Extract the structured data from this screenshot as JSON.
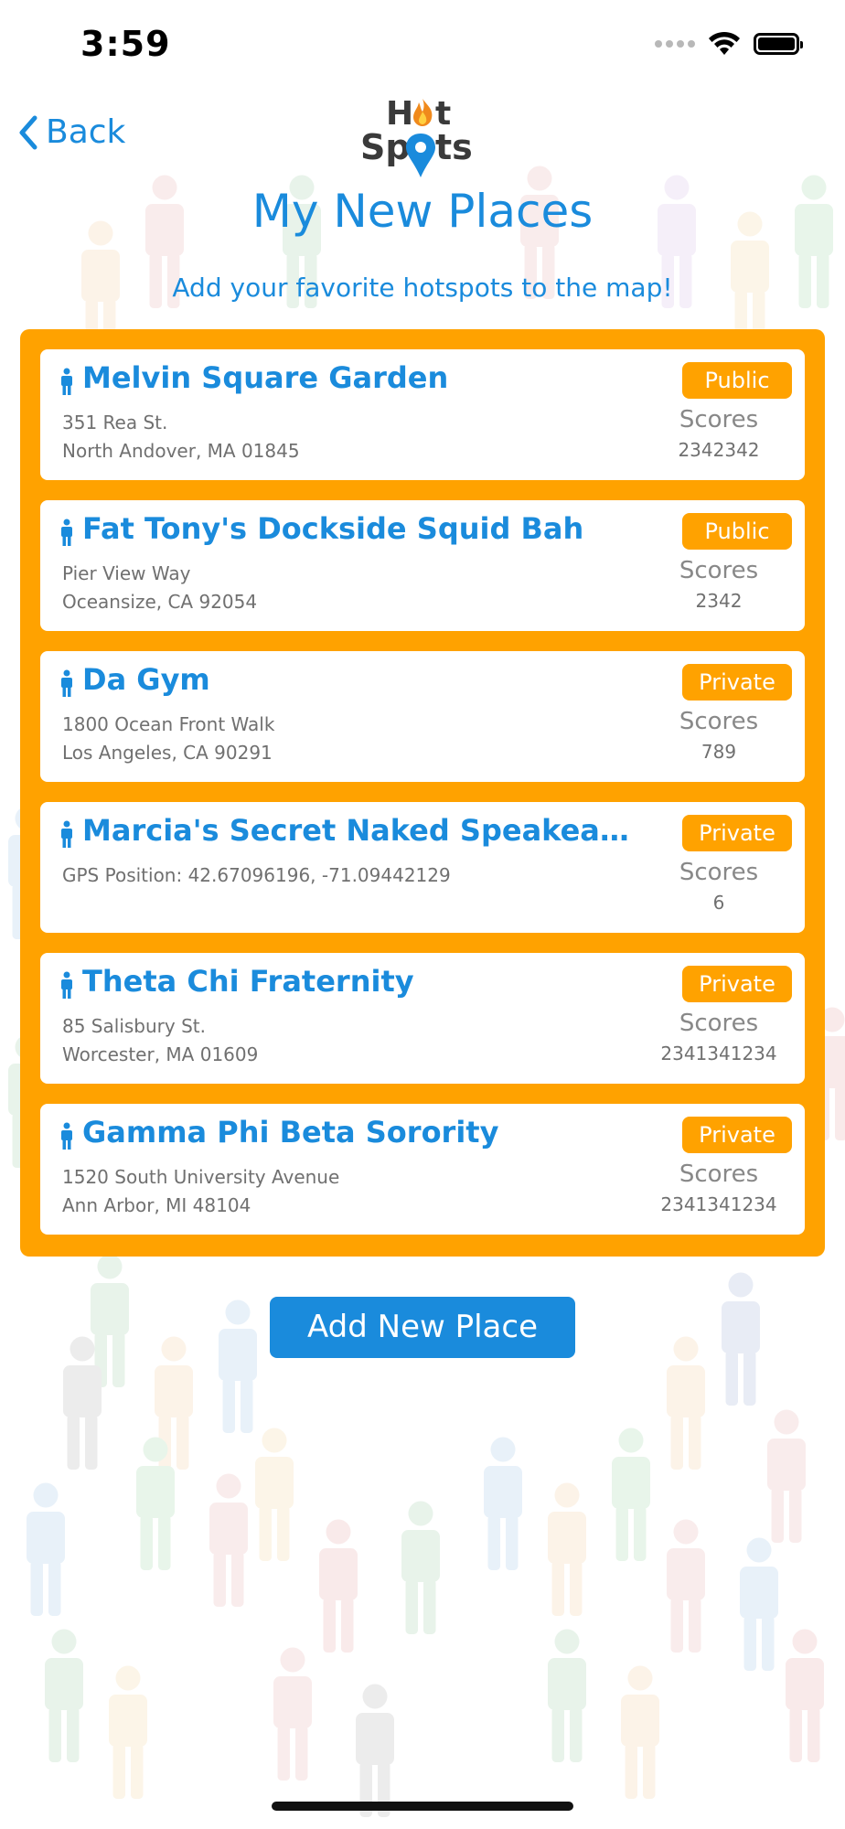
{
  "status_bar": {
    "time": "3:59"
  },
  "nav": {
    "back_label": "Back",
    "logo_text_line1": "Hot",
    "logo_text_line2": "Spots"
  },
  "header": {
    "title": "My New Places",
    "subtitle": "Add your favorite hotspots to the map!"
  },
  "places": [
    {
      "name": "Melvin Square Garden",
      "address_line1": "351 Rea St.",
      "address_line2": "North Andover, MA 01845",
      "visibility": "Public",
      "scores_label": "Scores",
      "score": "2342342"
    },
    {
      "name": "Fat Tony's Dockside Squid Bah",
      "address_line1": "Pier View Way",
      "address_line2": "Oceansize, CA 92054",
      "visibility": "Public",
      "scores_label": "Scores",
      "score": "2342"
    },
    {
      "name": "Da Gym",
      "address_line1": "1800 Ocean Front Walk",
      "address_line2": "Los Angeles, CA 90291",
      "visibility": "Private",
      "scores_label": "Scores",
      "score": "789"
    },
    {
      "name": "Marcia's Secret Naked Speakeasy & Hoo...",
      "address_line1": "GPS Position: 42.67096196, -71.09442129",
      "address_line2": "",
      "visibility": "Private",
      "scores_label": "Scores",
      "score": "6"
    },
    {
      "name": "Theta Chi Fraternity",
      "address_line1": "85 Salisbury St.",
      "address_line2": "Worcester, MA 01609",
      "visibility": "Private",
      "scores_label": "Scores",
      "score": "2341341234"
    },
    {
      "name": "Gamma Phi Beta Sorority",
      "address_line1": "1520 South University Avenue",
      "address_line2": "Ann Arbor, MI 48104",
      "visibility": "Private",
      "scores_label": "Scores",
      "score": "2341341234"
    }
  ],
  "actions": {
    "add_new_place": "Add New Place"
  },
  "colors": {
    "accent_blue": "#1a8bdc",
    "accent_orange": "#ffa200"
  },
  "icons": {
    "back": "chevron-left-icon",
    "place": "person-icon",
    "logo_pin": "map-pin-icon",
    "logo_flame": "flame-icon"
  }
}
